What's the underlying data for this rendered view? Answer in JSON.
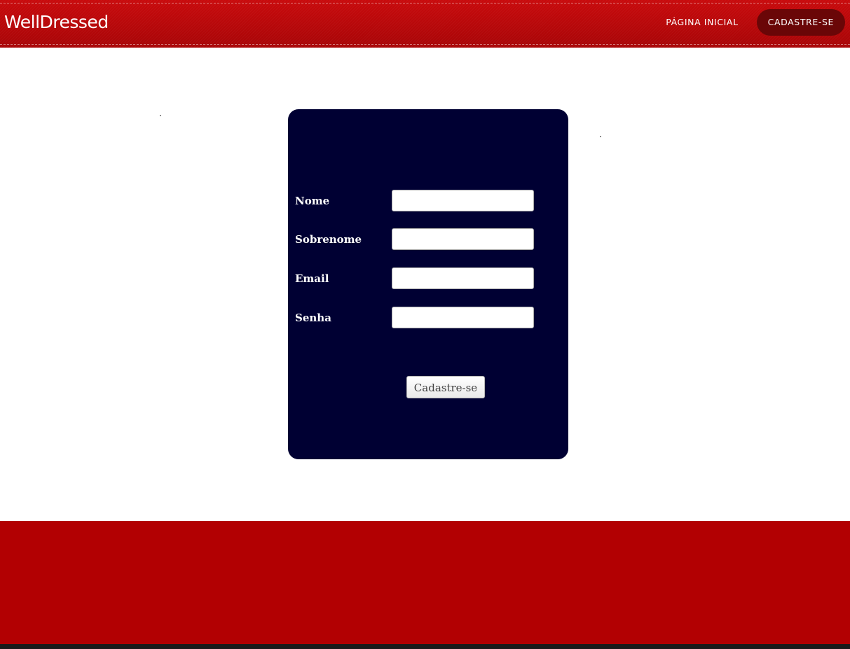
{
  "header": {
    "brand": "WellDressed",
    "nav": [
      {
        "label": "PÁGINA INICIAL",
        "active": false
      },
      {
        "label": "CADASTRE-SE",
        "active": true
      }
    ]
  },
  "decor": {
    "dot_left": ".",
    "dot_right": "."
  },
  "form": {
    "fields": [
      {
        "label": "Nome",
        "value": "",
        "placeholder": ""
      },
      {
        "label": "Sobrenome",
        "value": "",
        "placeholder": ""
      },
      {
        "label": "Email",
        "value": "",
        "placeholder": ""
      },
      {
        "label": "Senha",
        "value": "",
        "placeholder": ""
      }
    ],
    "submit_label": "Cadastre-se"
  },
  "colors": {
    "header": "#b50608",
    "nav_active": "#6a0607",
    "form_bg": "#000033",
    "footer": "#b20002",
    "footer_bar": "#1a1a1a"
  }
}
